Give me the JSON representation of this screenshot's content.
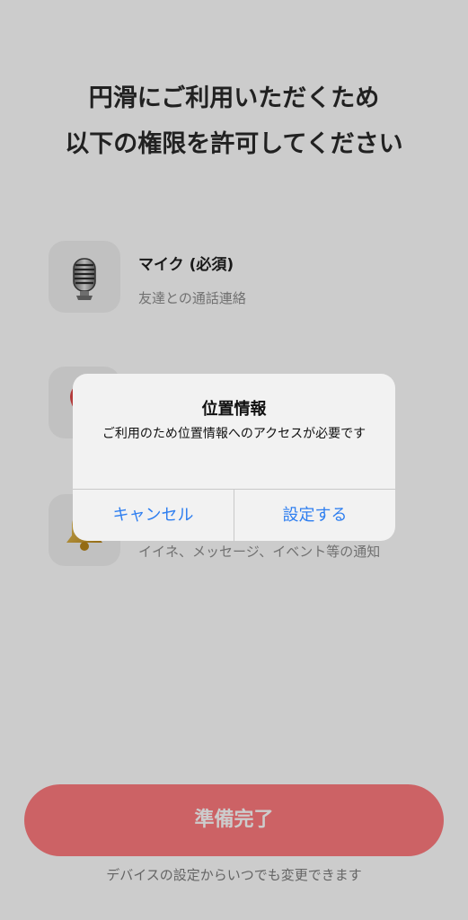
{
  "heading": {
    "line1": "円滑にご利用いただくため",
    "line2": "以下の権限を許可してください"
  },
  "permissions": [
    {
      "icon": "microphone-icon",
      "title": "マイク (必須)",
      "description": "友達との通話連絡"
    },
    {
      "icon": "location-icon",
      "title": "",
      "description": ""
    },
    {
      "icon": "bell-icon",
      "title": "",
      "description": "イイネ、メッセージ、イベント等の通知"
    }
  ],
  "alert": {
    "title": "位置情報",
    "message": "ご利用のため位置情報へのアクセスが必要です",
    "cancel_label": "キャンセル",
    "settings_label": "設定する"
  },
  "ready_button": {
    "label": "準備完了"
  },
  "footer": {
    "note": "デバイスの設定からいつでも変更できます"
  },
  "colors": {
    "accent": "#ff7b7f",
    "alert_button": "#2f7ff0",
    "overlay": "rgba(0,0,0,0.20)"
  }
}
